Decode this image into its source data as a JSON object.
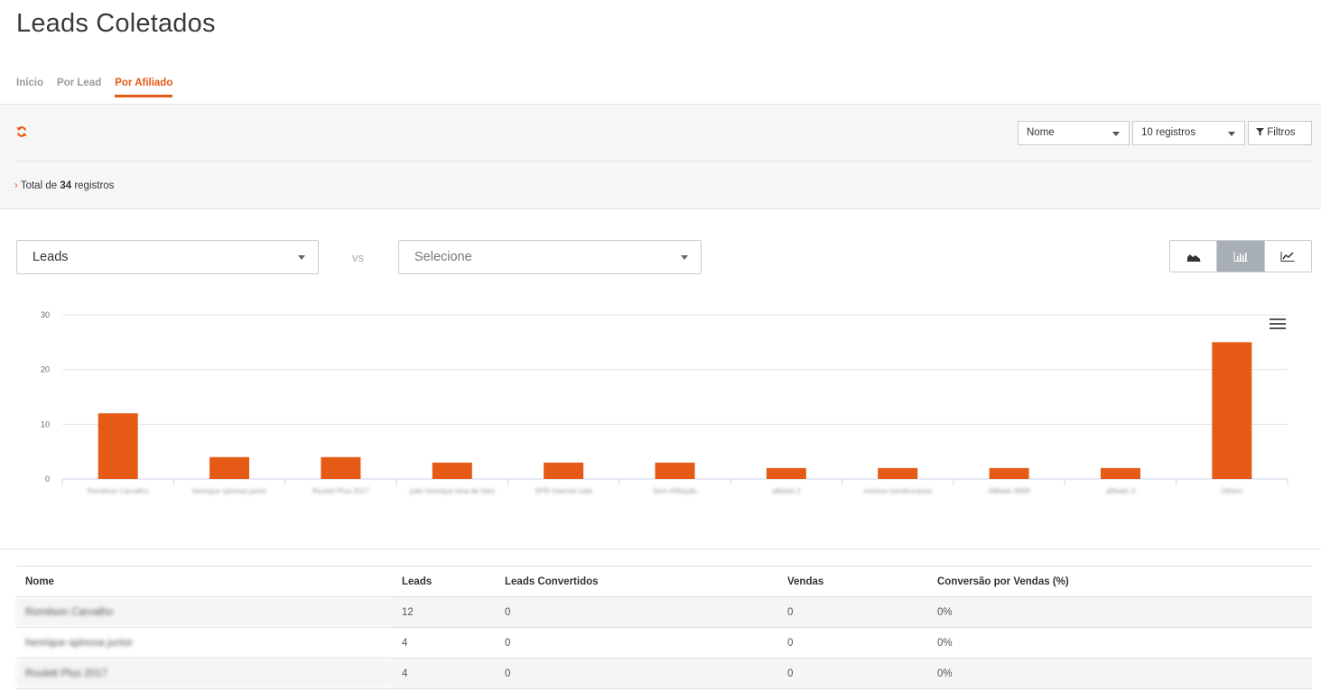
{
  "page": {
    "title": "Leads Coletados"
  },
  "tabs": [
    {
      "label": "Início",
      "active": false
    },
    {
      "label": "Por Lead",
      "active": false
    },
    {
      "label": "Por Afiliado",
      "active": true
    }
  ],
  "toolbar": {
    "refresh_icon": "refresh-icon",
    "sort_select": {
      "value": "Nome"
    },
    "page_size_select": {
      "value": "10 registros"
    },
    "filters_label": "Filtros",
    "total_prefix": "Total de",
    "total_count": "34",
    "total_suffix": "registros"
  },
  "comparison": {
    "metric_select": "Leads",
    "vs_label": "vs",
    "compare_select": "Selecione"
  },
  "chart_types": [
    "area-chart-icon",
    "bar-chart-icon",
    "line-chart-icon"
  ],
  "accent_color": "#e55a14",
  "chart_data": {
    "type": "bar",
    "categories": [
      "Romilson Carvalho",
      "henrique spinosa junior",
      "Roulett Plus 2017",
      "joão henrique lima de lobo",
      "SPR Internet Ltda",
      "Sem Afiliação",
      "afiliado 2",
      "monica mandrucasso",
      "Afiliado 9999",
      "afiliado 3",
      "Others"
    ],
    "values": [
      12,
      4,
      4,
      3,
      3,
      3,
      2,
      2,
      2,
      2,
      25
    ],
    "ylim": [
      0,
      30
    ],
    "yticks": [
      0,
      10,
      20,
      30
    ],
    "color": "#e55a14",
    "grid": true,
    "legend": "none"
  },
  "table": {
    "headers": [
      "Nome",
      "Leads",
      "Leads Convertidos",
      "Vendas",
      "Conversão por Vendas (%)"
    ],
    "rows": [
      [
        "Romilson Carvalho",
        "12",
        "0",
        "0",
        "0%"
      ],
      [
        "henrique spinosa junior",
        "4",
        "0",
        "0",
        "0%"
      ],
      [
        "Roulett Plus 2017",
        "4",
        "0",
        "0",
        "0%"
      ]
    ]
  }
}
